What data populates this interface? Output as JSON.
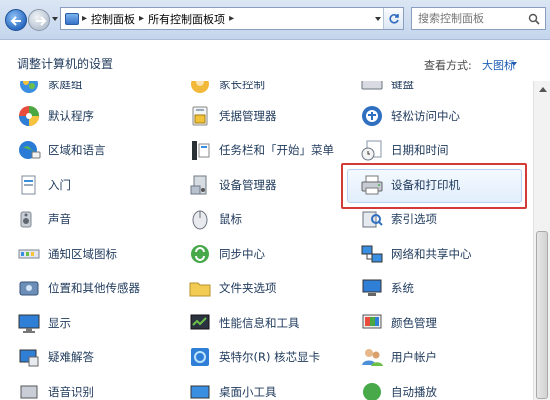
{
  "address": {
    "breadcrumbs": [
      "控制面板",
      "所有控制面板项"
    ],
    "search_placeholder": "搜索控制面板"
  },
  "header": {
    "title": "调整计算机的设置",
    "view_by_label": "查看方式:",
    "view_by_value": "大图标"
  },
  "items": {
    "c1": [
      "家庭组",
      "默认程序",
      "区域和语言",
      "入门",
      "声音",
      "通知区域图标",
      "位置和其他传感器",
      "显示",
      "疑难解答",
      "语音识别"
    ],
    "c2": [
      "家长控制",
      "凭据管理器",
      "任务栏和「开始」菜单",
      "设备管理器",
      "鼠标",
      "同步中心",
      "文件夹选项",
      "性能信息和工具",
      "英特尔(R) 核芯显卡",
      "桌面小工具"
    ],
    "c3": [
      "键盘",
      "轻松访问中心",
      "日期和时间",
      "设备和打印机",
      "索引选项",
      "网络和共享中心",
      "系统",
      "颜色管理",
      "用户帐户",
      "自动播放"
    ]
  },
  "highlighted_item": "设备和打印机",
  "colors": {
    "highlight_border": "#d23b37",
    "link_text": "#1e395b",
    "accent": "#1f5fb6"
  }
}
